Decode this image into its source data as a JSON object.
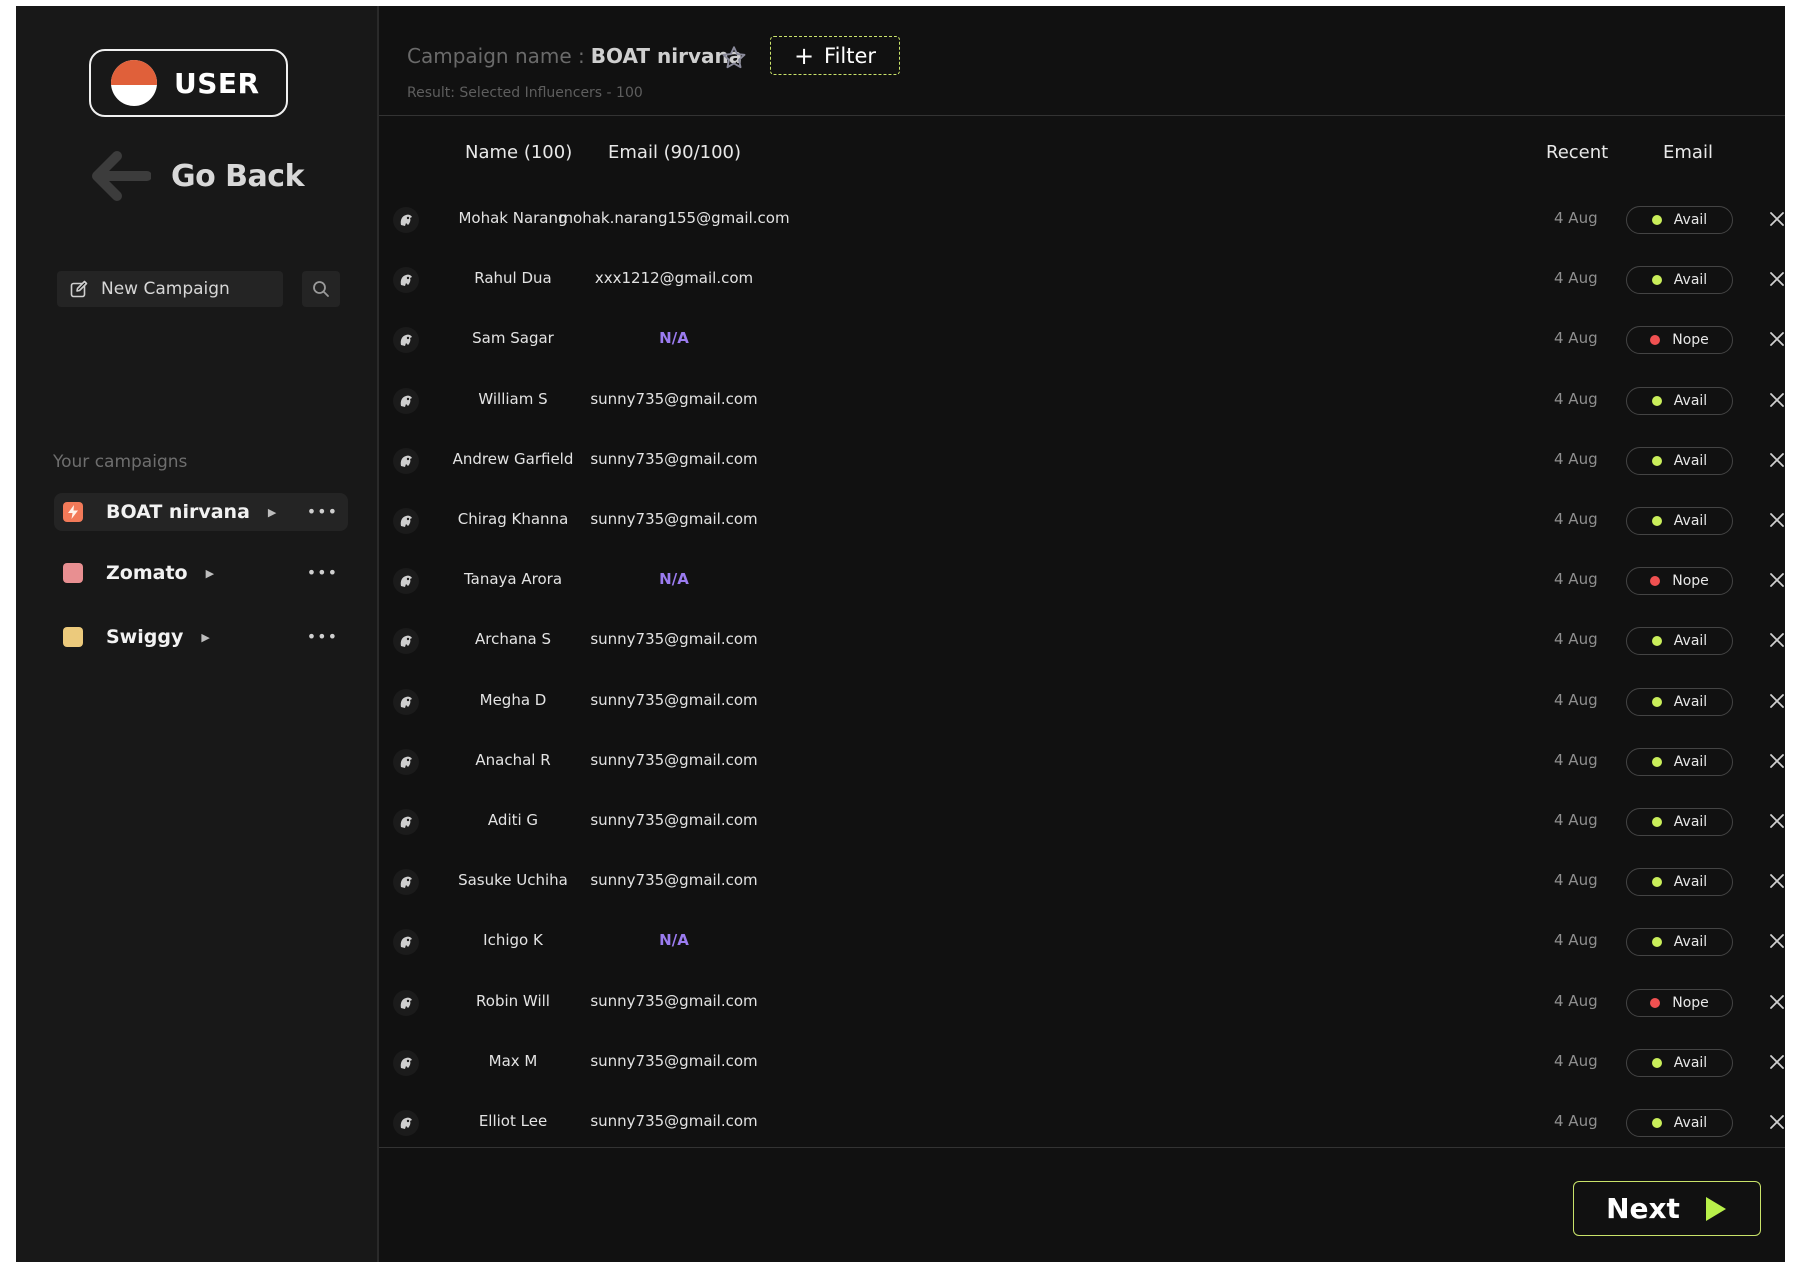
{
  "user": {
    "label": "USER"
  },
  "nav": {
    "go_back": "Go Back",
    "new_campaign": "New Campaign"
  },
  "sidebar": {
    "section_title": "Your campaigns",
    "campaigns": [
      {
        "label": "BOAT nirvana",
        "color": "#f27a59",
        "active": true
      },
      {
        "label": "Zomato",
        "color": "#e88f91",
        "active": false
      },
      {
        "label": "Swiggy",
        "color": "#ecca7c",
        "active": false
      }
    ]
  },
  "header": {
    "campaign_prefix": "Campaign name :",
    "campaign_name": "BOAT nirvana",
    "filter_label": "Filter",
    "result_text": "Result: Selected Influencers - 100"
  },
  "table": {
    "columns": {
      "name": "Name (100)",
      "email": "Email (90/100)",
      "recent": "Recent",
      "email_status": "Email"
    },
    "rows": [
      {
        "name": "Mohak Narang",
        "email": "mohak.narang155@gmail.com",
        "recent": "4 Aug",
        "status": "Avail"
      },
      {
        "name": "Rahul Dua",
        "email": "xxx1212@gmail.com",
        "recent": "4 Aug",
        "status": "Avail"
      },
      {
        "name": "Sam Sagar",
        "email": "N/A",
        "recent": "4 Aug",
        "status": "Nope"
      },
      {
        "name": "William S",
        "email": "sunny735@gmail.com",
        "recent": "4 Aug",
        "status": "Avail"
      },
      {
        "name": "Andrew Garfield",
        "email": "sunny735@gmail.com",
        "recent": "4 Aug",
        "status": "Avail"
      },
      {
        "name": "Chirag Khanna",
        "email": "sunny735@gmail.com",
        "recent": "4 Aug",
        "status": "Avail"
      },
      {
        "name": "Tanaya Arora",
        "email": "N/A",
        "recent": "4 Aug",
        "status": "Nope"
      },
      {
        "name": "Archana S",
        "email": "sunny735@gmail.com",
        "recent": "4 Aug",
        "status": "Avail"
      },
      {
        "name": "Megha D",
        "email": "sunny735@gmail.com",
        "recent": "4 Aug",
        "status": "Avail"
      },
      {
        "name": "Anachal R",
        "email": "sunny735@gmail.com",
        "recent": "4 Aug",
        "status": "Avail"
      },
      {
        "name": "Aditi G",
        "email": "sunny735@gmail.com",
        "recent": "4 Aug",
        "status": "Avail"
      },
      {
        "name": "Sasuke Uchiha",
        "email": "sunny735@gmail.com",
        "recent": "4 Aug",
        "status": "Avail"
      },
      {
        "name": "Ichigo K",
        "email": "N/A",
        "recent": "4 Aug",
        "status": "Avail"
      },
      {
        "name": "Robin Will",
        "email": "sunny735@gmail.com",
        "recent": "4 Aug",
        "status": "Nope"
      },
      {
        "name": "Max M",
        "email": "sunny735@gmail.com",
        "recent": "4 Aug",
        "status": "Avail"
      },
      {
        "name": "Elliot Lee",
        "email": "sunny735@gmail.com",
        "recent": "4 Aug",
        "status": "Avail"
      }
    ]
  },
  "footer": {
    "next_label": "Next"
  },
  "colors": {
    "avail": "#c9ee5a",
    "nope": "#f05151",
    "accent": "#c9e36a",
    "na": "#9b7cf0"
  }
}
